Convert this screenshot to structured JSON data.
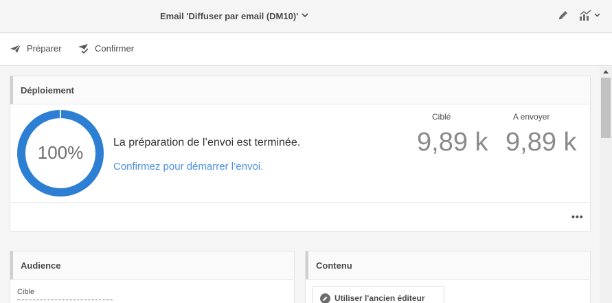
{
  "header": {
    "title": "Email 'Diffuser par email (DM10)'",
    "title_chevron": "⌄",
    "edit_icon": "pencil-icon",
    "report_icon": "report-chart-icon"
  },
  "toolbar": {
    "prepare_label": "Préparer",
    "confirm_label": "Confirmer"
  },
  "deployment": {
    "title": "Déploiement",
    "progress_percent_text": "100%",
    "progress_fraction": 1.0,
    "status_message": "La préparation de l’envoi est terminée.",
    "action_link": "Confirmez pour démarrer l’envoi.",
    "stats": [
      {
        "label": "Ciblé",
        "value": "9,89 k"
      },
      {
        "label": "A envoyer",
        "value": "9,89 k"
      }
    ],
    "more_label": "•••"
  },
  "audience": {
    "title": "Audience",
    "target_label": "Cible"
  },
  "content": {
    "title": "Contenu",
    "legacy_editor_label": "Utiliser l'ancien éditeur"
  },
  "colors": {
    "accent": "#2d7fd3",
    "link": "#4a90e2"
  }
}
